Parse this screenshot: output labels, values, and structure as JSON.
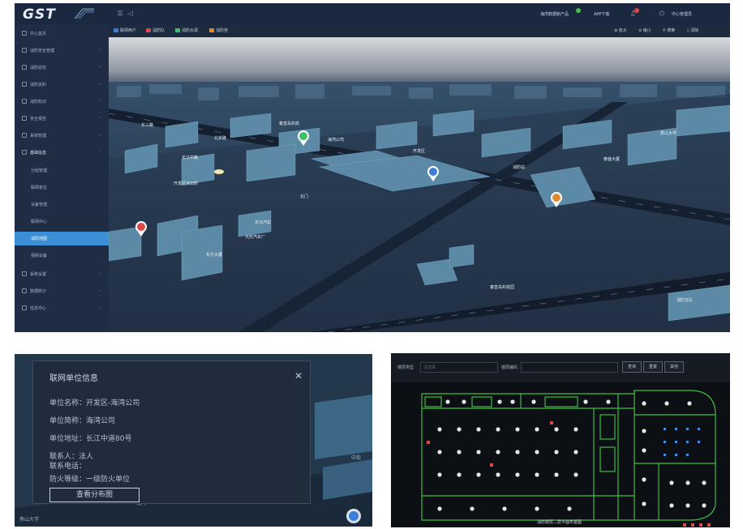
{
  "app": {
    "logo": "GST",
    "topbar": {
      "right_items": [
        "海湾数据新产品",
        "APP下载",
        "中心管理员"
      ],
      "status_color": "#48c24a",
      "alert_color": "#e64040"
    },
    "sidebar": {
      "items": [
        {
          "label": "中心首页",
          "icon": "home-icon"
        },
        {
          "label": "消防安全管理",
          "icon": "shield-icon",
          "expandable": true
        },
        {
          "label": "消防巡检",
          "icon": "check-icon",
          "expandable": true
        },
        {
          "label": "消防资料",
          "icon": "file-icon",
          "expandable": true
        },
        {
          "label": "消防知识",
          "icon": "book-icon",
          "expandable": true
        },
        {
          "label": "安全报告",
          "icon": "report-icon",
          "expandable": true
        },
        {
          "label": "系统管理",
          "icon": "gear-icon",
          "expandable": true
        },
        {
          "label": "基础信息",
          "icon": "info-icon",
          "expandable": true,
          "expanded": true
        }
      ],
      "subitems": [
        "分组管理",
        "联网单位",
        "设备管理",
        "联网中心",
        "消防地图",
        "视频设备"
      ],
      "active_subitem": "消防地图",
      "bottom_items": [
        {
          "label": "系统设置",
          "icon": "settings-icon"
        },
        {
          "label": "数据统计",
          "icon": "chart-icon"
        },
        {
          "label": "信息中心",
          "icon": "message-icon"
        }
      ]
    },
    "toolbar": {
      "layers": [
        {
          "label": "联网用户",
          "color": "#3d7fd8"
        },
        {
          "label": "消防队",
          "color": "#e04848"
        },
        {
          "label": "消防水源",
          "color": "#3fbf6a"
        },
        {
          "label": "消防栓",
          "color": "#e08a2e"
        }
      ],
      "tools": [
        "放大",
        "缩小",
        "搜索",
        "清除"
      ]
    },
    "map_labels": [
      "东三路",
      "长江中路",
      "北京路",
      "秦皇岛科技",
      "开发区",
      "海湾公司",
      "消防站",
      "燕山大学",
      "天马汽车",
      "东方大厦",
      "泰盛大厦",
      "北门",
      "大庆汽车厂",
      "秦皇岛科技园",
      "开发区派出所",
      "消防支队"
    ]
  },
  "info_dialog": {
    "title": "联网单位信息",
    "close": "✕",
    "fields": [
      {
        "label": "单位名称",
        "value": "开发区-海湾公司"
      },
      {
        "label": "单位简称",
        "value": "海湾公司"
      },
      {
        "label": "单位地址",
        "value": "长江中道80号"
      },
      {
        "label": "联系人",
        "value": "法人"
      },
      {
        "label": "联系电话",
        "value": ""
      },
      {
        "label": "防火等级",
        "value": "一级防火单位"
      }
    ],
    "button": "查看分布图",
    "bg_labels": [
      "北门",
      "中街",
      "燕山大学"
    ]
  },
  "floor_plan": {
    "filter_label_1": "楼层类型",
    "filter_placeholder_1": "请选择",
    "filter_label_2": "楼层编码",
    "buttons": [
      "查询",
      "重置",
      "其他"
    ],
    "caption": "消防楼层二层平面布置图"
  }
}
